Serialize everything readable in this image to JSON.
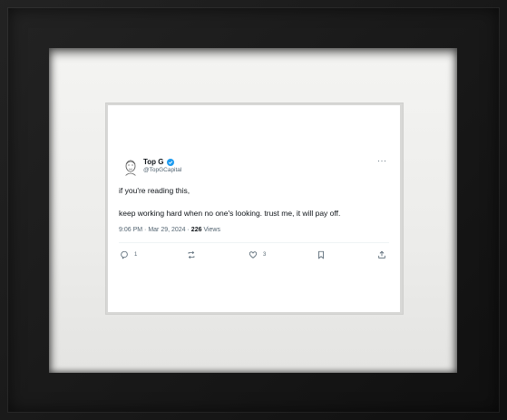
{
  "tweet": {
    "name": "Top G",
    "handle": "@TopGCapital",
    "more_label": "···",
    "lines": [
      "if you're reading this,",
      "keep working hard when no one's looking. trust me, it will pay off."
    ],
    "time": "9:06 PM",
    "date": "Mar 29, 2024",
    "views_count": "226",
    "views_label": "Views",
    "replies": "1",
    "likes": "3",
    "accent_color": "#1d9bf0"
  }
}
